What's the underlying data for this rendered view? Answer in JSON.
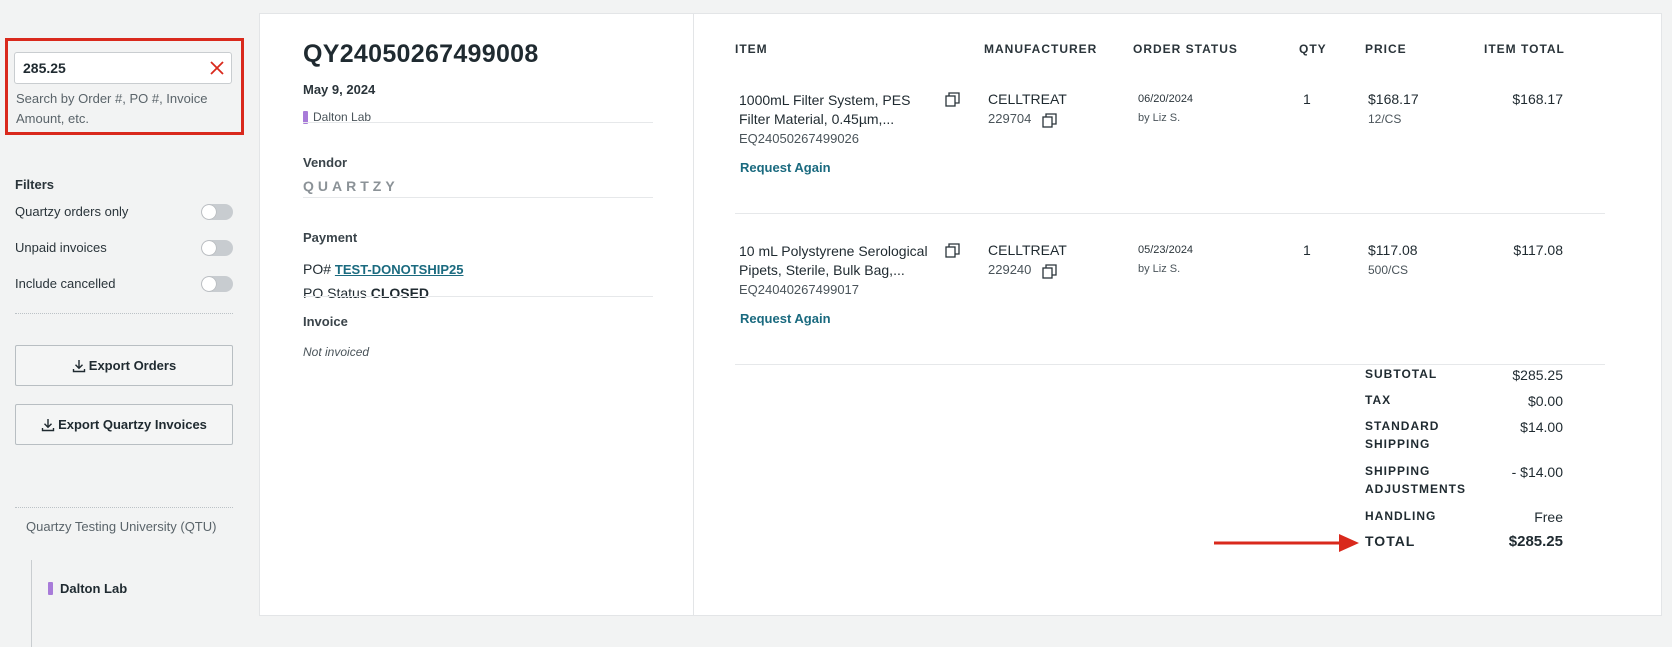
{
  "search": {
    "value": "285.25",
    "hint": "Search by Order #, PO #, Invoice Amount, etc."
  },
  "filters": {
    "title": "Filters",
    "items": [
      {
        "label": "Quartzy orders only",
        "on": false
      },
      {
        "label": "Unpaid invoices",
        "on": false
      },
      {
        "label": "Include cancelled",
        "on": false
      }
    ]
  },
  "exports": {
    "orders_label": "Export Orders",
    "invoices_label": "Export Quartzy Invoices"
  },
  "org": {
    "name": "Quartzy Testing University (QTU)",
    "lab": "Dalton Lab",
    "lab_color": "#a87bd9"
  },
  "order": {
    "number": "QY24050267499008",
    "date": "May 9, 2024",
    "lab": "Dalton Lab",
    "vendor_label": "Vendor",
    "vendor_logo": "QUARTZY",
    "payment_label": "Payment",
    "po_prefix": "PO#",
    "po_number": "TEST-DONOTSHIP25",
    "po_status_prefix": "PO Status",
    "po_status": "CLOSED",
    "invoice_label": "Invoice",
    "invoice_status": "Not invoiced"
  },
  "table": {
    "headers": {
      "item": "ITEM",
      "manufacturer": "MANUFACTURER",
      "order_status": "ORDER STATUS",
      "qty": "QTY",
      "price": "PRICE",
      "item_total": "ITEM TOTAL"
    },
    "rows": [
      {
        "name": "1000mL Filter System, PES Filter Material, 0.45µm,...",
        "eq": "EQ24050267499026",
        "request_again": "Request Again",
        "manufacturer": "CELLTREAT",
        "mfr_num": "229704",
        "status_date": "06/20/2024",
        "status_by": "by Liz S.",
        "qty": "1",
        "price": "$168.17",
        "unit": "12/CS",
        "total": "$168.17"
      },
      {
        "name": "10 mL Polystyrene Serological Pipets, Sterile, Bulk Bag,...",
        "eq": "EQ24040267499017",
        "request_again": "Request Again",
        "manufacturer": "CELLTREAT",
        "mfr_num": "229240",
        "status_date": "05/23/2024",
        "status_by": "by Liz S.",
        "qty": "1",
        "price": "$117.08",
        "unit": "500/CS",
        "total": "$117.08"
      }
    ]
  },
  "totals": {
    "subtotal_label": "SUBTOTAL",
    "subtotal": "$285.25",
    "tax_label": "TAX",
    "tax": "$0.00",
    "shipping_label": "STANDARD SHIPPING",
    "shipping": "$14.00",
    "adjust_label": "SHIPPING ADJUSTMENTS",
    "adjust": "- $14.00",
    "handling_label": "HANDLING",
    "handling": "Free",
    "total_label": "TOTAL",
    "total": "$285.25"
  },
  "colors": {
    "highlight": "#d9291c",
    "link": "#1a6a7f",
    "lab_marker": "#a87bd9"
  }
}
